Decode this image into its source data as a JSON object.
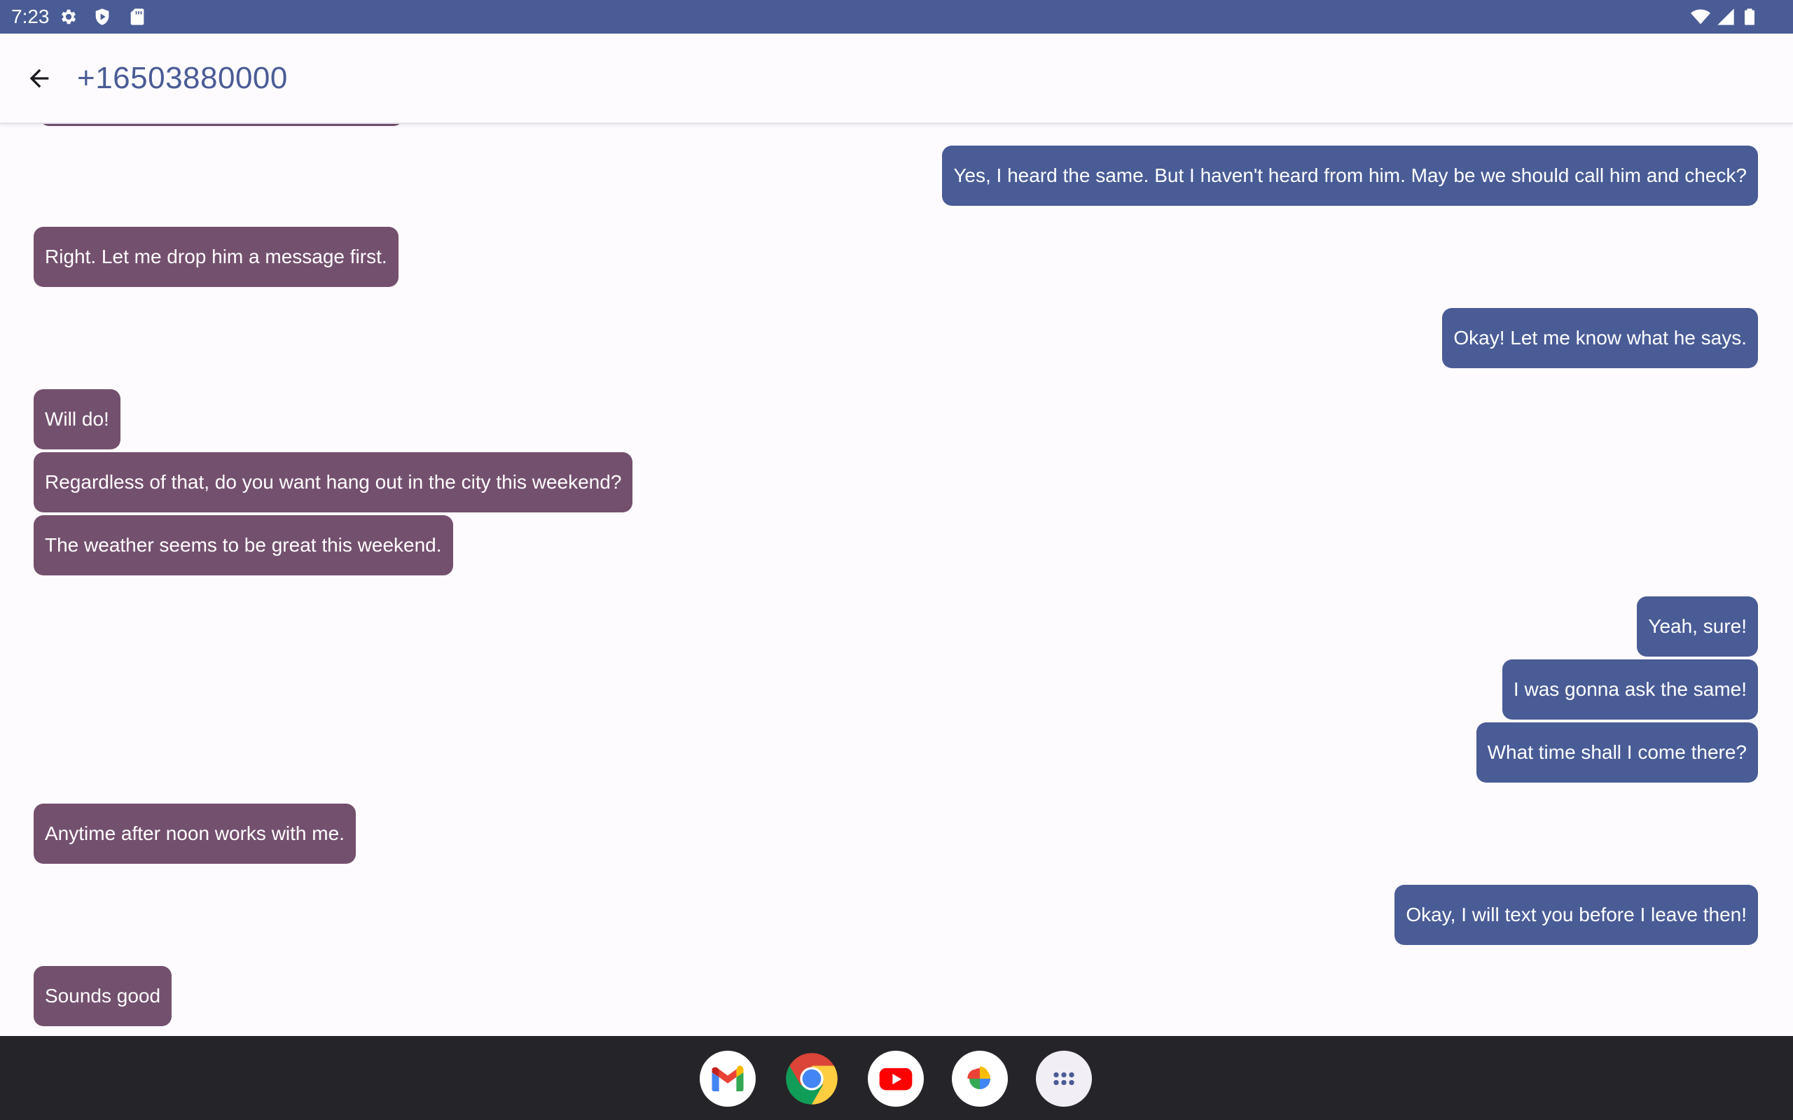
{
  "status_bar": {
    "time": "7:23",
    "left_icons": [
      "settings-icon",
      "shield-icon",
      "sd-card-icon"
    ],
    "right_icons": [
      "wifi-icon",
      "cell-signal-icon",
      "battery-icon"
    ],
    "background_color": "#4a5c96"
  },
  "header": {
    "back_icon": "arrow-back-icon",
    "title": "+16503880000"
  },
  "colors": {
    "incoming_bubble": "#74506f",
    "outgoing_bubble": "#4a5c96",
    "background": "#fefbff",
    "taskbar": "#252428"
  },
  "messages": [
    {
      "direction": "outgoing",
      "text": "Yes, I heard the same. But I haven't heard from him. May be we should call him and check?"
    },
    {
      "direction": "incoming",
      "text": "Right. Let me drop him a message first."
    },
    {
      "direction": "outgoing",
      "text": "Okay! Let me know what he says."
    },
    {
      "direction": "incoming",
      "text": "Will do!"
    },
    {
      "direction": "incoming",
      "text": "Regardless of that, do you want hang out in the city this weekend?"
    },
    {
      "direction": "incoming",
      "text": "The weather seems to be great this weekend."
    },
    {
      "direction": "outgoing",
      "text": "Yeah, sure!"
    },
    {
      "direction": "outgoing",
      "text": "I was gonna ask the same!"
    },
    {
      "direction": "outgoing",
      "text": "What time shall I come there?"
    },
    {
      "direction": "incoming",
      "text": "Anytime after noon works with me."
    },
    {
      "direction": "outgoing",
      "text": "Okay, I will text you before I leave then!"
    },
    {
      "direction": "incoming",
      "text": "Sounds good"
    }
  ],
  "taskbar": {
    "apps": [
      "gmail-icon",
      "chrome-icon",
      "youtube-icon",
      "photos-icon",
      "app-drawer-icon"
    ]
  }
}
